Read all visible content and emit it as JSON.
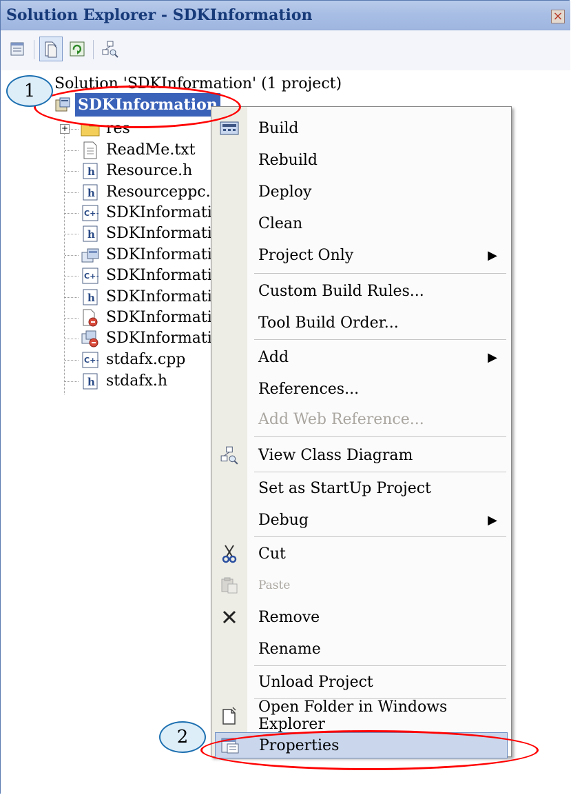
{
  "window": {
    "title": "Solution Explorer - SDKInformation",
    "close_glyph": "×"
  },
  "toolbar": {
    "icons": [
      "properties-icon",
      "show-all-files-icon",
      "refresh-icon",
      "view-class-diagram-icon"
    ]
  },
  "tree": {
    "solution_label": "Solution 'SDKInformation' (1 project)",
    "project_label": "SDKInformation",
    "items": [
      {
        "label": "res",
        "icon": "folder-icon"
      },
      {
        "label": "ReadMe.txt",
        "icon": "text-file-icon"
      },
      {
        "label": "Resource.h",
        "icon": "header-file-icon"
      },
      {
        "label": "Resourceppc.h",
        "icon": "header-file-icon"
      },
      {
        "label": "SDKInformatior",
        "icon": "cpp-file-icon"
      },
      {
        "label": "SDKInformatior",
        "icon": "header-file-icon"
      },
      {
        "label": "SDKInformatior",
        "icon": "resource-file-icon"
      },
      {
        "label": "SDKInformatior",
        "icon": "cpp-file-icon"
      },
      {
        "label": "SDKInformatior",
        "icon": "header-file-icon"
      },
      {
        "label": "SDKInformatior",
        "icon": "rc-file-icon"
      },
      {
        "label": "SDKInformatior",
        "icon": "rc2-file-icon"
      },
      {
        "label": "stdafx.cpp",
        "icon": "cpp-file-icon"
      },
      {
        "label": "stdafx.h",
        "icon": "header-file-icon"
      }
    ]
  },
  "menu": {
    "items": [
      {
        "label": "Build",
        "icon": "build-icon"
      },
      {
        "label": "Rebuild"
      },
      {
        "label": "Deploy"
      },
      {
        "label": "Clean"
      },
      {
        "label": "Project Only",
        "submenu_glyph": "▶"
      },
      {
        "label": "Custom Build Rules..."
      },
      {
        "label": "Tool Build Order..."
      },
      {
        "label": "Add",
        "submenu_glyph": "▶"
      },
      {
        "label": "References..."
      },
      {
        "label": "Add Web Reference...",
        "state": "disabled"
      },
      {
        "label": "View Class Diagram",
        "icon": "class-diagram-icon"
      },
      {
        "label": "Set as StartUp Project"
      },
      {
        "label": "Debug",
        "submenu_glyph": "▶"
      },
      {
        "label": "Cut",
        "icon": "scissors-icon"
      },
      {
        "label": "Paste",
        "icon": "paste-icon",
        "state": "disabled"
      },
      {
        "label": "Remove",
        "icon": "x-icon"
      },
      {
        "label": "Rename"
      },
      {
        "label": "Unload Project"
      },
      {
        "label": "Open Folder in Windows Explorer",
        "icon": "folder-page-icon"
      },
      {
        "label": "Properties",
        "icon": "properties-icon",
        "state": "hover"
      }
    ]
  },
  "callouts": [
    {
      "number": "1"
    },
    {
      "number": "2"
    }
  ],
  "colors": {
    "title_bar": "#a7bde4",
    "title_text": "#173a79",
    "selection": "#3a62b9",
    "menu_gutter": "#eeede5",
    "menu_hover": "#c9d6ec",
    "annotation_red": "#ff0000",
    "callout_border": "#1c6fb0"
  }
}
